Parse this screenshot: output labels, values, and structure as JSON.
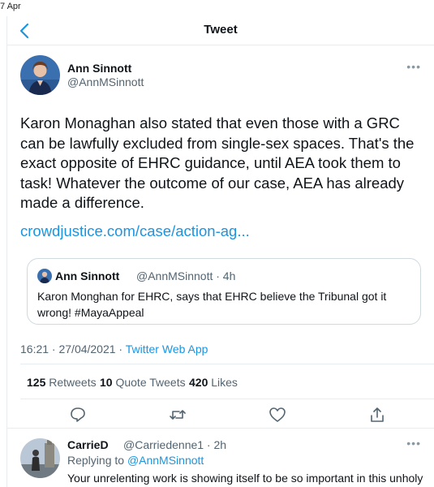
{
  "status": {
    "text": "7 Apr"
  },
  "header": {
    "title": "Tweet",
    "back_icon": "chevron-left-icon"
  },
  "tweet": {
    "author_name": "Ann Sinnott",
    "author_handle": "@AnnMSinnott",
    "text": "Karon Monaghan also stated that even those with a GRC can be lawfully excluded from single-sex spaces. That's the exact opposite of EHRC guidance, until AEA took them to task! Whatever the outcome of our case, AEA has already made a difference.",
    "link": "crowdjustice.com/case/action-ag...",
    "quote": {
      "author_name": "Ann Sinnott",
      "author_handle": "@AnnMSinnott · 4h",
      "text": "Karon Monghan for EHRC, says that EHRC believe the Tribunal got it wrong! #MayaAppeal"
    },
    "timestamp": "16:21 · 27/04/2021 · ",
    "source": "Twitter Web App",
    "stats": {
      "retweets_count": "125",
      "retweets_label": "Retweets",
      "quotes_count": "10",
      "quotes_label": "Quote Tweets",
      "likes_count": "420",
      "likes_label": "Likes"
    },
    "actions": [
      "reply-icon",
      "retweet-icon",
      "like-icon",
      "share-icon"
    ]
  },
  "reply": {
    "author_name": "CarrieD",
    "author_handle": "@Carriedenne1 · 2h",
    "replying_prefix": "Replying to ",
    "replying_to": "@AnnMSinnott",
    "text": "Your unrelenting work is showing itself to be so important in this unholy"
  },
  "colors": {
    "link": "#1b95e0",
    "muted": "#536471",
    "border": "#e6ecf0"
  }
}
